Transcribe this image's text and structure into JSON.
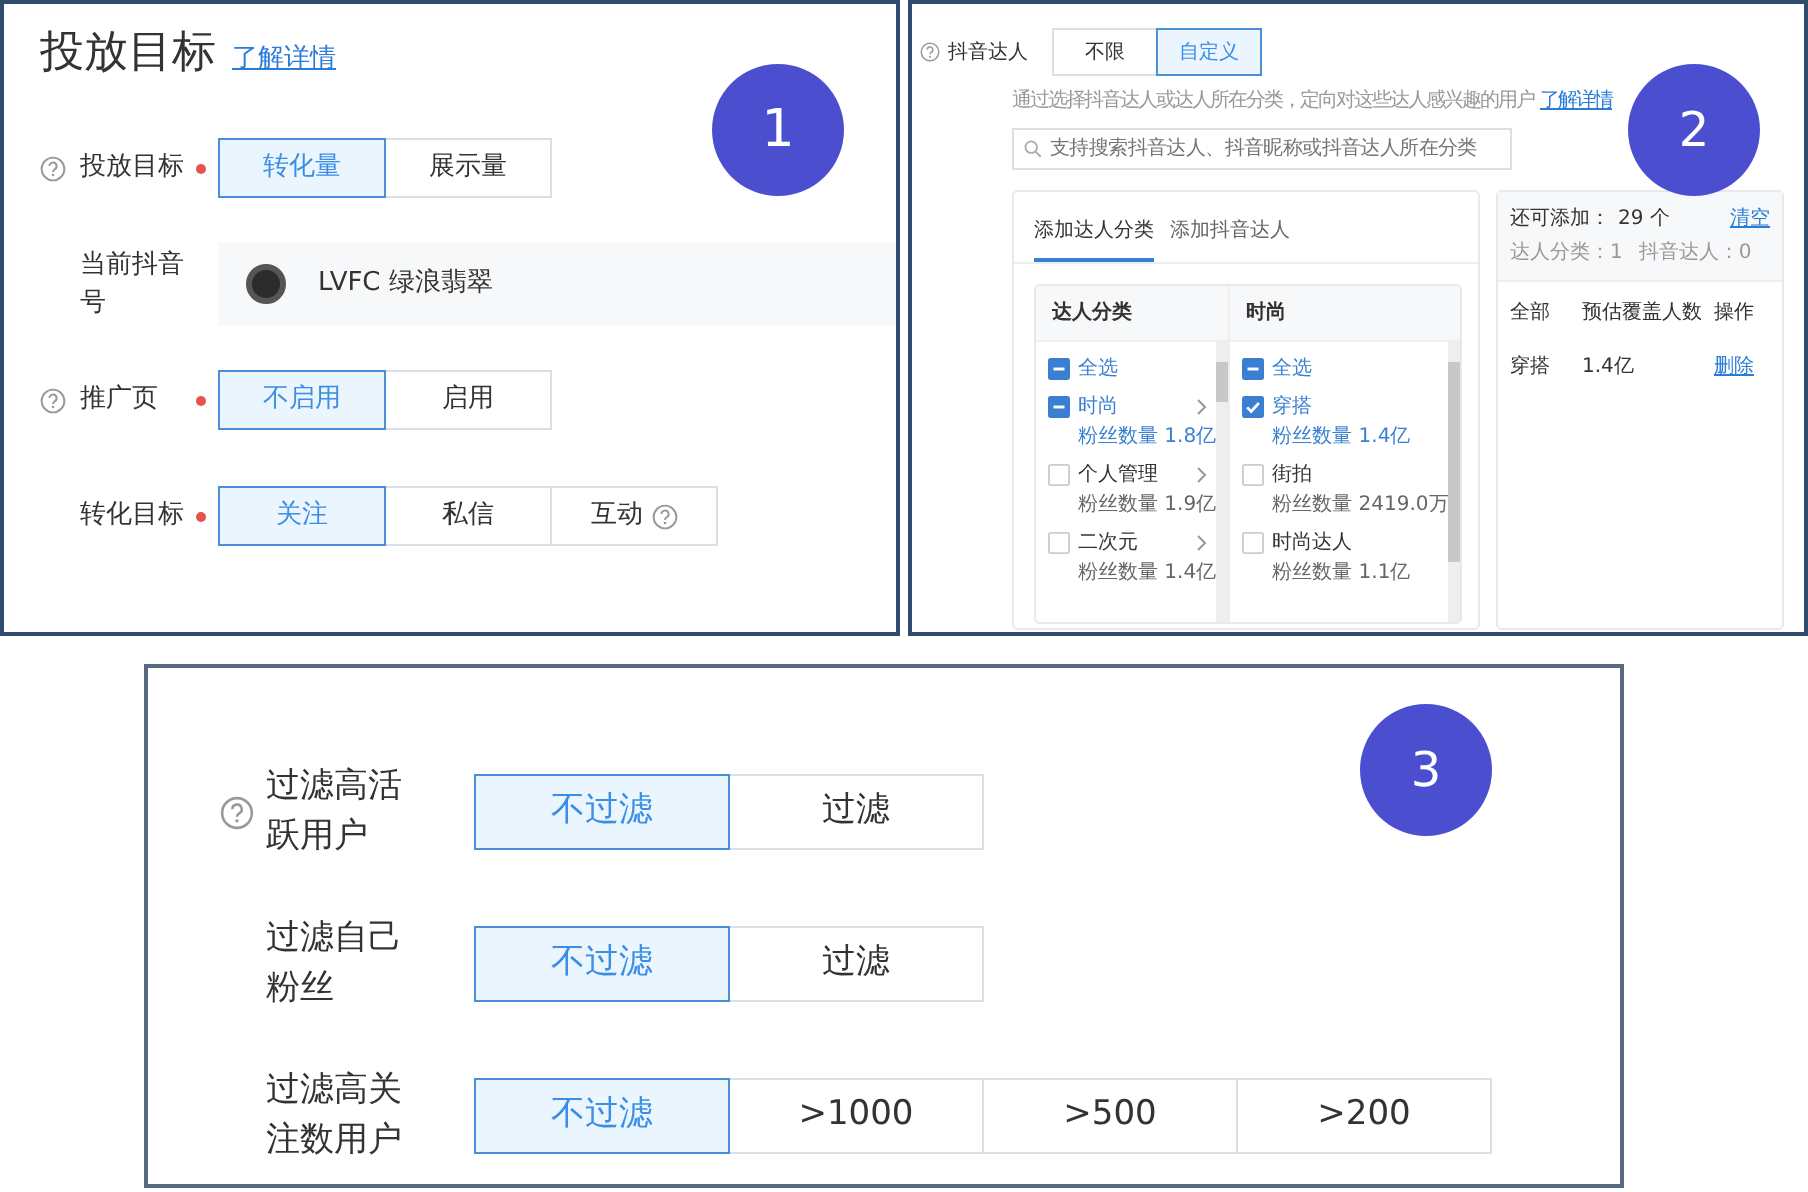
{
  "panel_1": {
    "badge": "1",
    "title": "投放目标",
    "title_link": "了解详情",
    "rows": [
      {
        "kind": "segmented",
        "help": true,
        "label": "投放目标",
        "required": true,
        "options": [
          {
            "label": "转化量",
            "selected": true,
            "help": false
          },
          {
            "label": "展示量",
            "selected": false,
            "help": false
          }
        ]
      },
      {
        "kind": "account",
        "help": false,
        "label": "当前抖音号",
        "required": false,
        "value": "LVFC 绿浪翡翠"
      },
      {
        "kind": "segmented",
        "help": true,
        "label": "推广页",
        "required": true,
        "options": [
          {
            "label": "不启用",
            "selected": true,
            "help": false
          },
          {
            "label": "启用",
            "selected": false,
            "help": false
          }
        ]
      },
      {
        "kind": "segmented",
        "help": false,
        "label": "转化目标",
        "required": true,
        "options": [
          {
            "label": "关注",
            "selected": true,
            "help": false
          },
          {
            "label": "私信",
            "selected": false,
            "help": false
          },
          {
            "label": "互动",
            "selected": false,
            "help": true
          }
        ]
      }
    ]
  },
  "panel_2": {
    "badge": "2",
    "help": true,
    "label": "抖音达人",
    "options": [
      {
        "label": "不限",
        "selected": false
      },
      {
        "label": "自定义",
        "selected": true
      }
    ],
    "description": "通过选择抖音达人或达人所在分类，定向对这些达人感兴趣的用户",
    "description_link": "了解详情",
    "search": {
      "placeholder": "支持搜索抖音达人、抖音昵称或抖音达人所在分类"
    },
    "tabs": [
      {
        "label": "添加达人分类",
        "selected": true
      },
      {
        "label": "添加抖音达人",
        "selected": false
      }
    ],
    "columns": [
      {
        "header": "达人分类",
        "items": [
          {
            "label": "全选",
            "checked": false,
            "indeterminate": true,
            "has_children": false
          },
          {
            "label": "时尚",
            "fans": "粉丝数量 1.8亿",
            "checked": false,
            "indeterminate": true,
            "has_children": true
          },
          {
            "label": "个人管理",
            "fans": "粉丝数量 1.9亿",
            "checked": false,
            "indeterminate": false,
            "has_children": true
          },
          {
            "label": "二次元",
            "fans": "粉丝数量 1.4亿",
            "checked": false,
            "indeterminate": false,
            "has_children": true
          }
        ]
      },
      {
        "header": "时尚",
        "items": [
          {
            "label": "全选",
            "checked": false,
            "indeterminate": true,
            "has_children": false
          },
          {
            "label": "穿搭",
            "fans": "粉丝数量 1.4亿",
            "checked": true,
            "indeterminate": false,
            "has_children": false
          },
          {
            "label": "街拍",
            "fans": "粉丝数量 2419.0万",
            "checked": false,
            "indeterminate": false,
            "has_children": false
          },
          {
            "label": "时尚达人",
            "fans": "粉丝数量 1.1亿",
            "checked": false,
            "indeterminate": false,
            "has_children": false
          }
        ]
      }
    ],
    "summary": {
      "remaining_label": "还可添加：",
      "remaining": "29 个",
      "clear": "清空",
      "counts": [
        "达人分类：1",
        "抖音达人：0"
      ],
      "table": {
        "columns": [
          "全部",
          "预估覆盖人数",
          "操作"
        ],
        "rows": [
          {
            "name": "穿搭",
            "reach": "1.4亿",
            "action": "删除"
          }
        ]
      }
    }
  },
  "panel_3": {
    "badge": "3",
    "rows": [
      {
        "help": true,
        "label": "过滤高活跃用户",
        "options": [
          {
            "label": "不过滤",
            "selected": true
          },
          {
            "label": "过滤",
            "selected": false
          }
        ]
      },
      {
        "help": false,
        "label": "过滤自己粉丝",
        "options": [
          {
            "label": "不过滤",
            "selected": true
          },
          {
            "label": "过滤",
            "selected": false
          }
        ]
      },
      {
        "help": false,
        "label": "过滤高关注数用户",
        "options": [
          {
            "label": "不过滤",
            "selected": true
          },
          {
            "label": ">1000",
            "selected": false
          },
          {
            "label": ">500",
            "selected": false
          },
          {
            "label": ">200",
            "selected": false
          }
        ]
      }
    ]
  }
}
